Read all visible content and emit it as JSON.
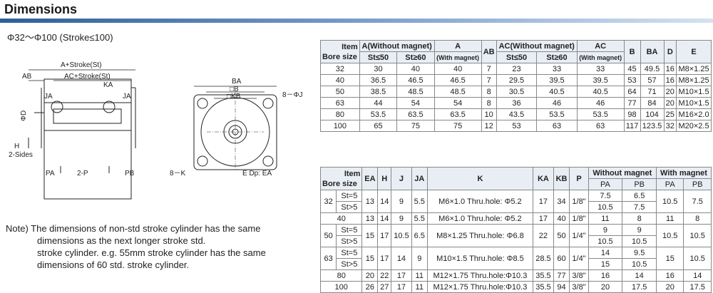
{
  "header": {
    "title": "Dimensions"
  },
  "range_label": "Φ32～Φ100 (Stroke≤100)",
  "drawing": {
    "labels": {
      "a_stroke": "A+Stroke(St)",
      "ab": "AB",
      "ac_stroke": "AC+Stroke(St)",
      "ka": "KA",
      "ja": "JA",
      "ja2": "JA",
      "phi_d": "ΦD",
      "h": "H",
      "two_sides": "2-Sides",
      "pa": "PA",
      "two_p": "2-P",
      "pb": "PB",
      "ba": "BA",
      "b": "□B",
      "kb": "□KB",
      "eight_phi_j": "8－ΦJ",
      "eight_k": "8－K",
      "e_dp_ea": "E Dp: EA"
    }
  },
  "note": {
    "lines": [
      "Note) The dimensions of non-std stroke cylinder has the same",
      "dimensions as the next longer stroke std.",
      "stroke cylinder. e.g. 55mm stroke cylinder has the same",
      "dimensions of 60 std. stroke cylinder."
    ]
  },
  "table1": {
    "h_item": "Item",
    "h_bore": "Bore size",
    "h_a_wo": "A(Without magnet)",
    "h_a": "A",
    "h_with": "(With magnet)",
    "h_ab": "AB",
    "h_ac_wo": "AC(Without magnet)",
    "h_ac": "AC",
    "h_with2": "(With magnet)",
    "h_b": "B",
    "h_ba": "BA",
    "h_d": "D",
    "h_e": "E",
    "h_st1": "St≤50",
    "h_st2": "St≥60",
    "h_st3": "St≤50",
    "h_st4": "St≥60",
    "rows": [
      [
        "32",
        "30",
        "40",
        "40",
        "7",
        "23",
        "33",
        "33",
        "45",
        "49.5",
        "16",
        "M8×1.25"
      ],
      [
        "40",
        "36.5",
        "46.5",
        "46.5",
        "7",
        "29.5",
        "39.5",
        "39.5",
        "53",
        "57",
        "16",
        "M8×1.25"
      ],
      [
        "50",
        "38.5",
        "48.5",
        "48.5",
        "8",
        "30.5",
        "40.5",
        "40.5",
        "64",
        "71",
        "20",
        "M10×1.5"
      ],
      [
        "63",
        "44",
        "54",
        "54",
        "8",
        "36",
        "46",
        "46",
        "77",
        "84",
        "20",
        "M10×1.5"
      ],
      [
        "80",
        "53.5",
        "63.5",
        "63.5",
        "10",
        "43.5",
        "53.5",
        "53.5",
        "98",
        "104",
        "25",
        "M16×2.0"
      ],
      [
        "100",
        "65",
        "75",
        "75",
        "12",
        "53",
        "63",
        "63",
        "117",
        "123.5",
        "32",
        "M20×2.5"
      ]
    ]
  },
  "table2": {
    "h_item": "Item",
    "h_bore": "Bore size",
    "h_ea": "EA",
    "h_h": "H",
    "h_j": "J",
    "h_ja": "JA",
    "h_k": "K",
    "h_ka": "KA",
    "h_kb": "KB",
    "h_p": "P",
    "h_without": "Without magnet",
    "h_with": "With magnet",
    "h_pa1": "PA",
    "h_pb1": "PB",
    "h_pa2": "PA",
    "h_pb2": "PB",
    "r32": {
      "bore": "32",
      "s1": "St=5",
      "s2": "St>5",
      "ea": "13",
      "h": "14",
      "j": "9",
      "ja": "5.5",
      "k": "M6×1.0 Thru.hole: Φ5.2",
      "ka": "17",
      "kb": "34",
      "p": "1/8\"",
      "pa_a": "7.5",
      "pb_a": "6.5",
      "pa_b": "10.5",
      "pb_b": "7.5",
      "wpa": "10.5",
      "wpb": "7.5"
    },
    "r40": {
      "bore": "40",
      "ea": "13",
      "h": "14",
      "j": "9",
      "ja": "5.5",
      "k": "M6×1.0 Thru.hole: Φ5.2",
      "ka": "17",
      "kb": "40",
      "p": "1/8\"",
      "pa": "11",
      "pb": "8",
      "wpa": "11",
      "wpb": "8"
    },
    "r50": {
      "bore": "50",
      "s1": "St=5",
      "s2": "St>5",
      "ea": "15",
      "h": "17",
      "j": "10.5",
      "ja": "6.5",
      "k": "M8×1.25 Thru.hole: Φ6.8",
      "ka": "22",
      "kb": "50",
      "p": "1/4\"",
      "pa_a": "9",
      "pb_a": "9",
      "pa_b": "10.5",
      "pb_b": "10.5",
      "wpa": "10.5",
      "wpb": "10.5"
    },
    "r63": {
      "bore": "63",
      "s1": "St=5",
      "s2": "St>5",
      "ea": "15",
      "h": "17",
      "j": "14",
      "ja": "9",
      "k": "M10×1.5 Thru.hole: Φ8.5",
      "ka": "28.5",
      "kb": "60",
      "p": "1/4\"",
      "pa_a": "14",
      "pb_a": "9.5",
      "pa_b": "15",
      "pb_b": "10.5",
      "wpa": "15",
      "wpb": "10.5"
    },
    "r80": {
      "bore": "80",
      "ea": "20",
      "h": "22",
      "j": "17",
      "ja": "11",
      "k": "M12×1.75 Thru.hole:Φ10.3",
      "ka": "35.5",
      "kb": "77",
      "p": "3/8\"",
      "pa": "16",
      "pb": "14",
      "wpa": "16",
      "wpb": "14"
    },
    "r100": {
      "bore": "100",
      "ea": "26",
      "h": "27",
      "j": "17",
      "ja": "11",
      "k": "M12×1.75 Thru.hole:Φ10.3",
      "ka": "35.5",
      "kb": "94",
      "p": "3/8\"",
      "pa": "20",
      "pb": "17.5",
      "wpa": "20",
      "wpb": "17.5"
    }
  }
}
